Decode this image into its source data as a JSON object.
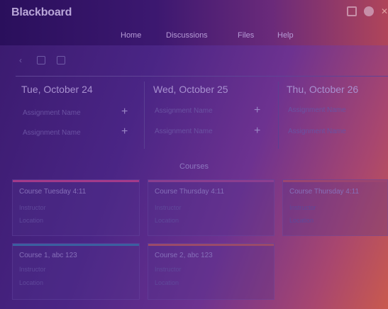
{
  "app": {
    "logo": "Blackboard"
  },
  "nav": {
    "items": [
      "Home",
      "Discussions",
      "Files",
      "Help"
    ]
  },
  "toolbar": {
    "icons": [
      "chevron-left-icon",
      "calendar-icon",
      "mail-icon"
    ]
  },
  "days": [
    {
      "title": "Tue, October 24",
      "rows": [
        {
          "label": "Assignment Name"
        },
        {
          "label": "Assignment Name"
        }
      ]
    },
    {
      "title": "Wed, October 25",
      "rows": [
        {
          "label": "Assignment Name"
        },
        {
          "label": "Assignment Name"
        }
      ]
    },
    {
      "title": "Thu, October 26",
      "rows": [
        {
          "label": "Assignment Name"
        },
        {
          "label": "Assignment Name"
        }
      ]
    }
  ],
  "courses": {
    "heading": "Courses",
    "cards": [
      {
        "title": "Course Tuesday 4:11",
        "l1": "Instructor",
        "l2": "Location",
        "color": "#a33a8a"
      },
      {
        "title": "Course Thursday 4:11",
        "l1": "Instructor",
        "l2": "Location",
        "color": "#8b3e8f"
      },
      {
        "title": "Course Thursday 4:11",
        "l1": "Instructor",
        "l2": "Location",
        "color": "#9b4570"
      },
      {
        "title": "Course 1, abc 123",
        "l1": "Instructor",
        "l2": "Location",
        "color": "#3b5fa0"
      },
      {
        "title": "Course 2, abc 123",
        "l1": "Instructor",
        "l2": "Location",
        "color": "#9a4a6a"
      }
    ]
  }
}
